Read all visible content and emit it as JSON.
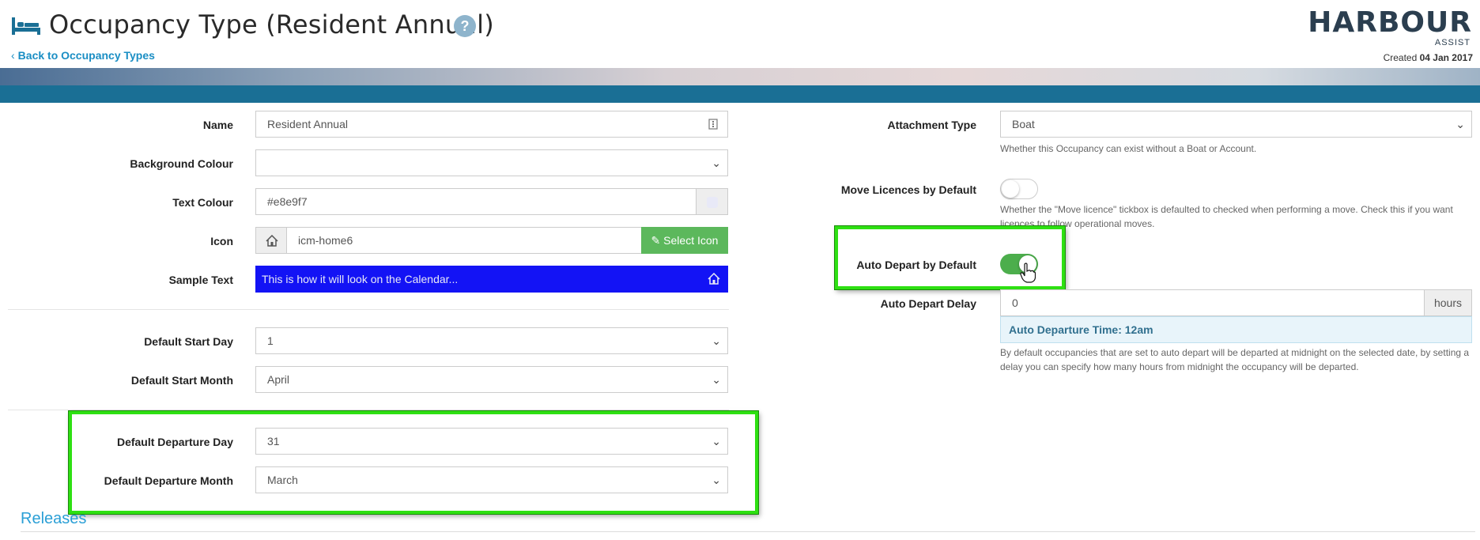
{
  "header": {
    "title": "Occupancy Type (Resident Annual)",
    "help": "?",
    "back_label": "Back to Occupancy Types",
    "logo_main": "HARBOUR",
    "logo_sub": "ASSIST",
    "created_prefix": "Created",
    "created_date": "04 Jan 2017"
  },
  "form_left": {
    "name": {
      "label": "Name",
      "value": "Resident Annual"
    },
    "background_colour": {
      "label": "Background Colour",
      "value": ""
    },
    "text_colour": {
      "label": "Text Colour",
      "value": "#e8e9f7"
    },
    "icon": {
      "label": "Icon",
      "value": "icm-home6",
      "button": "Select Icon"
    },
    "sample_text": {
      "label": "Sample Text",
      "value": "This is how it will look on the Calendar..."
    },
    "default_start_day": {
      "label": "Default Start Day",
      "value": "1"
    },
    "default_start_month": {
      "label": "Default Start Month",
      "value": "April"
    },
    "default_departure_day": {
      "label": "Default Departure Day",
      "value": "31"
    },
    "default_departure_month": {
      "label": "Default Departure Month",
      "value": "March"
    }
  },
  "form_right": {
    "attachment_type": {
      "label": "Attachment Type",
      "value": "Boat",
      "hint": "Whether this Occupancy can exist without a Boat or Account."
    },
    "move_licences": {
      "label": "Move Licences by Default",
      "state": "off",
      "hint_line1": "Whether the \"Move licence\" tickbox is defaulted to checked when performing a move. Check this if you want",
      "hint_line2": "licences to follow operational moves."
    },
    "auto_depart": {
      "label": "Auto Depart by Default",
      "state": "on"
    },
    "auto_depart_delay": {
      "label": "Auto Depart Delay",
      "value": "0",
      "addon": "hours"
    },
    "departure_time": "Auto Departure Time: 12am",
    "delay_hint_line1": "By default occupancies that are set to auto depart will be departed at midnight on the selected date, by setting a",
    "delay_hint_line2": "delay you can specify how many hours from midnight the occupancy will be departed."
  },
  "releases_heading": "Releases",
  "colors": {
    "accent_blue": "#1a8ec4",
    "bar_blue": "#1a6f95",
    "select_icon_green": "#5cb85c",
    "sample_bg": "#1313f5",
    "highlight_green": "#2ee012"
  },
  "icons": [
    "bed-icon",
    "question-icon",
    "chevron-left-icon",
    "home-icon",
    "edit-icon",
    "chevron-down-icon",
    "pointer-hand-icon",
    "kebab-icon"
  ]
}
